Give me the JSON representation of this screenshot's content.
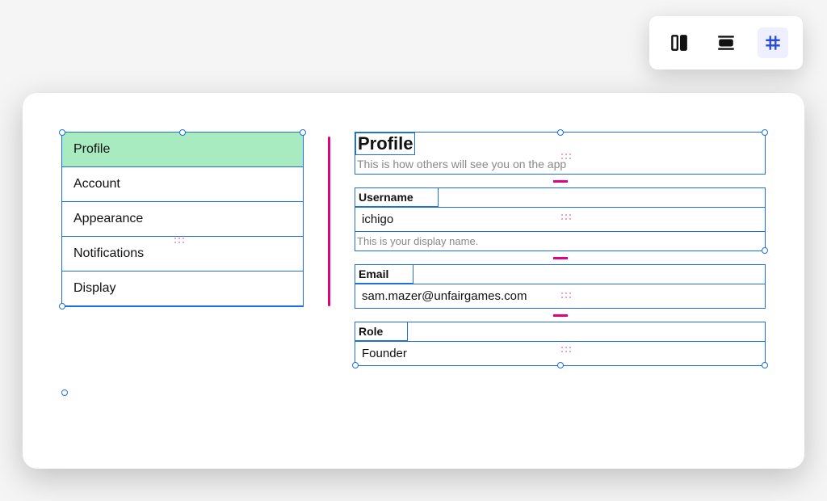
{
  "toolbar": {
    "icons": [
      "columns-icon",
      "rows-icon",
      "grid-icon"
    ],
    "active_index": 2
  },
  "sidebar": {
    "items": [
      {
        "label": "Profile",
        "selected": true
      },
      {
        "label": "Account",
        "selected": false
      },
      {
        "label": "Appearance",
        "selected": false
      },
      {
        "label": "Notifications",
        "selected": false
      },
      {
        "label": "Display",
        "selected": false
      }
    ]
  },
  "content": {
    "title": "Profile",
    "subtitle": "This is how others will see you on the app",
    "fields": {
      "username": {
        "label": "Username",
        "value": "ichigo",
        "helper": "This is your display name."
      },
      "email": {
        "label": "Email",
        "value": "sam.mazer@unfairgames.com"
      },
      "role": {
        "label": "Role",
        "value": "Founder"
      }
    }
  },
  "colors": {
    "selection_border": "#1e6fd9",
    "accent_pink": "#e6007e",
    "nav_selected_bg": "#a9ebc0"
  }
}
